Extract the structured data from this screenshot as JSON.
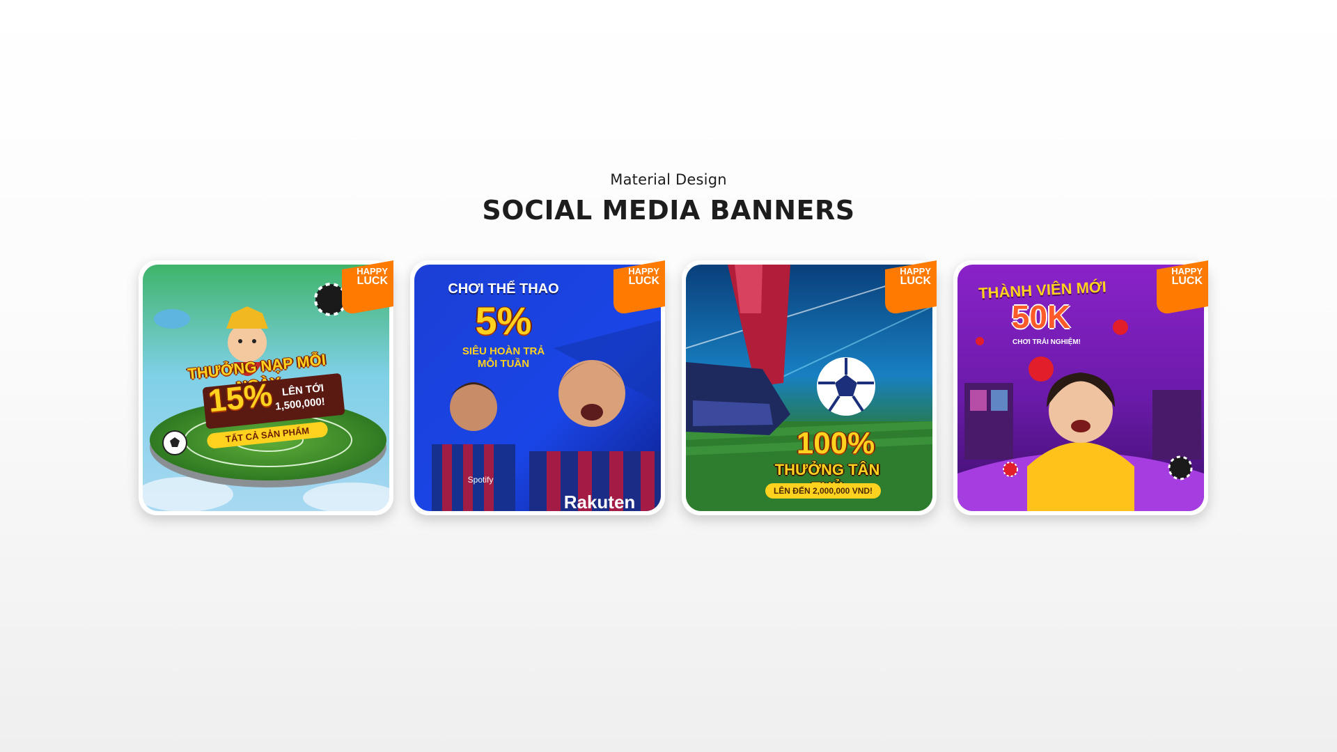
{
  "header": {
    "subtitle": "Material Design",
    "title": "SOCIAL MEDIA BANNERS"
  },
  "brand": {
    "logo_line1": "HAPPY",
    "logo_line2": "LUCK",
    "logo_color": "#ff7a00"
  },
  "banners": [
    {
      "headline": "THƯỞNG NẠP MỖI NGÀY",
      "percent": "15%",
      "upto_line1": "LÊN TỚI",
      "upto_line2": "1,500,000!",
      "button": "TẤT CẢ SẢN PHẨM"
    },
    {
      "headline": "CHƠI THỂ THAO",
      "percent": "5%",
      "line1": "SIÊU HOÀN TRẢ",
      "line2": "MỖI TUẦN",
      "shirt_text_1": "Spotify",
      "shirt_text_2": "Rakuten"
    },
    {
      "percent": "100%",
      "headline": "THƯỞNG TÂN THỦ",
      "button": "LÊN ĐẾN 2,000,000 VND!"
    },
    {
      "headline": "THÀNH VIÊN MỚI",
      "amount": "50K",
      "subline": "CHƠI TRẢI NGHIỆM!"
    }
  ]
}
